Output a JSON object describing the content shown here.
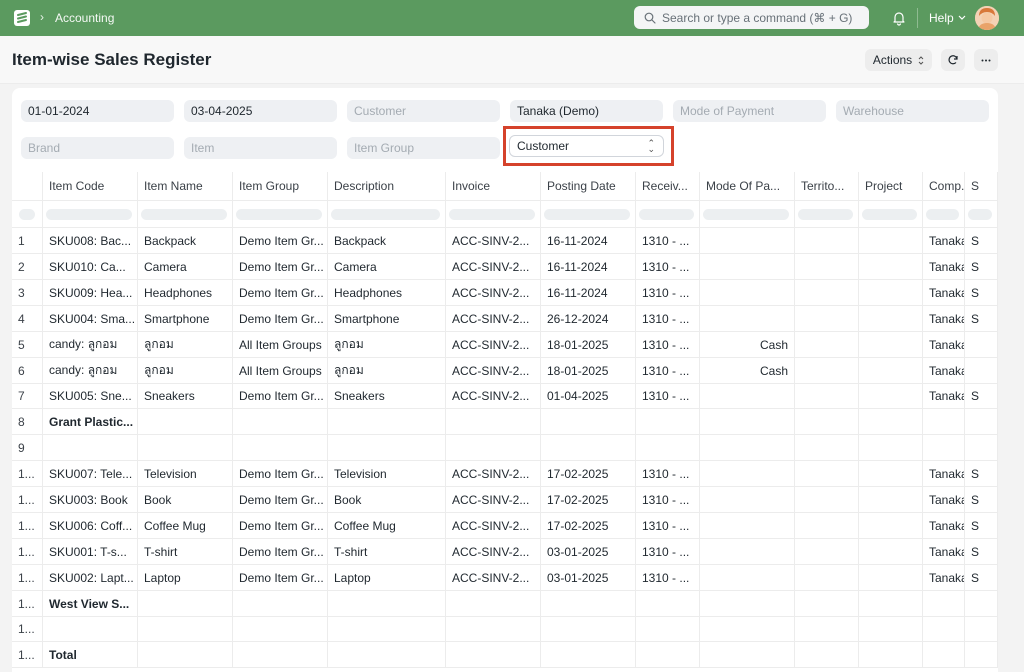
{
  "nav": {
    "breadcrumb": "Accounting",
    "search_placeholder": "Search or type a command (⌘ + G)",
    "help_label": "Help"
  },
  "page": {
    "title": "Item-wise Sales Register",
    "actions_label": "Actions"
  },
  "filters": {
    "from_date": "01-01-2024",
    "to_date": "03-04-2025",
    "customer_placeholder": "Customer",
    "company": "Tanaka (Demo)",
    "mode_of_payment_placeholder": "Mode of Payment",
    "warehouse_placeholder": "Warehouse",
    "brand_placeholder": "Brand",
    "item_placeholder": "Item",
    "item_group_placeholder": "Item Group",
    "group_by_value": "Customer"
  },
  "table": {
    "columns": [
      "Item Code",
      "Item Name",
      "Item Group",
      "Description",
      "Invoice",
      "Posting Date",
      "Receiv...",
      "Mode Of Pa...",
      "Territo...",
      "Project",
      "Comp...",
      "S"
    ],
    "rows": [
      {
        "n": "1",
        "item_code": "SKU008: Bac...",
        "item_name": "Backpack",
        "item_group": "Demo Item Gr...",
        "description": "Backpack",
        "invoice": "ACC-SINV-2...",
        "posting_date": "16-11-2024",
        "receivable": "1310 - ...",
        "mode_of_payment": "",
        "territory": "",
        "project": "",
        "company": "Tanaka ...",
        "s": "S"
      },
      {
        "n": "2",
        "item_code": "SKU010: Ca...",
        "item_name": "Camera",
        "item_group": "Demo Item Gr...",
        "description": "Camera",
        "invoice": "ACC-SINV-2...",
        "posting_date": "16-11-2024",
        "receivable": "1310 - ...",
        "mode_of_payment": "",
        "territory": "",
        "project": "",
        "company": "Tanaka ...",
        "s": "S"
      },
      {
        "n": "3",
        "item_code": "SKU009: Hea...",
        "item_name": "Headphones",
        "item_group": "Demo Item Gr...",
        "description": "Headphones",
        "invoice": "ACC-SINV-2...",
        "posting_date": "16-11-2024",
        "receivable": "1310 - ...",
        "mode_of_payment": "",
        "territory": "",
        "project": "",
        "company": "Tanaka ...",
        "s": "S"
      },
      {
        "n": "4",
        "item_code": "SKU004: Sma...",
        "item_name": "Smartphone",
        "item_group": "Demo Item Gr...",
        "description": "Smartphone",
        "invoice": "ACC-SINV-2...",
        "posting_date": "26-12-2024",
        "receivable": "1310 - ...",
        "mode_of_payment": "",
        "territory": "",
        "project": "",
        "company": "Tanaka ...",
        "s": "S"
      },
      {
        "n": "5",
        "item_code": "candy: ลูกอม",
        "item_name": "ลูกอม",
        "item_group": "All Item Groups",
        "description": "ลูกอม",
        "invoice": "ACC-SINV-2...",
        "posting_date": "18-01-2025",
        "receivable": "1310 - ...",
        "mode_of_payment": "Cash",
        "territory": "",
        "project": "",
        "company": "Tanaka ...",
        "s": ""
      },
      {
        "n": "6",
        "item_code": "candy: ลูกอม",
        "item_name": "ลูกอม",
        "item_group": "All Item Groups",
        "description": "ลูกอม",
        "invoice": "ACC-SINV-2...",
        "posting_date": "18-01-2025",
        "receivable": "1310 - ...",
        "mode_of_payment": "Cash",
        "territory": "",
        "project": "",
        "company": "Tanaka ...",
        "s": ""
      },
      {
        "n": "7",
        "item_code": "SKU005: Sne...",
        "item_name": "Sneakers",
        "item_group": "Demo Item Gr...",
        "description": "Sneakers",
        "invoice": "ACC-SINV-2...",
        "posting_date": "01-04-2025",
        "receivable": "1310 - ...",
        "mode_of_payment": "",
        "territory": "",
        "project": "",
        "company": "Tanaka ...",
        "s": "S"
      },
      {
        "n": "8",
        "item_code": "Grant Plastic...",
        "bold": true,
        "item_name": "",
        "item_group": "",
        "description": "",
        "invoice": "",
        "posting_date": "",
        "receivable": "",
        "mode_of_payment": "",
        "territory": "",
        "project": "",
        "company": "",
        "s": ""
      },
      {
        "n": "9",
        "item_code": "",
        "item_name": "",
        "item_group": "",
        "description": "",
        "invoice": "",
        "posting_date": "",
        "receivable": "",
        "mode_of_payment": "",
        "territory": "",
        "project": "",
        "company": "",
        "s": ""
      },
      {
        "n": "1...",
        "item_code": "SKU007: Tele...",
        "item_name": "Television",
        "item_group": "Demo Item Gr...",
        "description": "Television",
        "invoice": "ACC-SINV-2...",
        "posting_date": "17-02-2025",
        "receivable": "1310 - ...",
        "mode_of_payment": "",
        "territory": "",
        "project": "",
        "company": "Tanaka ...",
        "s": "S"
      },
      {
        "n": "1...",
        "item_code": "SKU003: Book",
        "item_name": "Book",
        "item_group": "Demo Item Gr...",
        "description": "Book",
        "invoice": "ACC-SINV-2...",
        "posting_date": "17-02-2025",
        "receivable": "1310 - ...",
        "mode_of_payment": "",
        "territory": "",
        "project": "",
        "company": "Tanaka ...",
        "s": "S"
      },
      {
        "n": "1...",
        "item_code": "SKU006: Coff...",
        "item_name": "Coffee Mug",
        "item_group": "Demo Item Gr...",
        "description": "Coffee Mug",
        "invoice": "ACC-SINV-2...",
        "posting_date": "17-02-2025",
        "receivable": "1310 - ...",
        "mode_of_payment": "",
        "territory": "",
        "project": "",
        "company": "Tanaka ...",
        "s": "S"
      },
      {
        "n": "1...",
        "item_code": "SKU001: T-s...",
        "item_name": "T-shirt",
        "item_group": "Demo Item Gr...",
        "description": "T-shirt",
        "invoice": "ACC-SINV-2...",
        "posting_date": "03-01-2025",
        "receivable": "1310 - ...",
        "mode_of_payment": "",
        "territory": "",
        "project": "",
        "company": "Tanaka ...",
        "s": "S"
      },
      {
        "n": "1...",
        "item_code": "SKU002: Lapt...",
        "item_name": "Laptop",
        "item_group": "Demo Item Gr...",
        "description": "Laptop",
        "invoice": "ACC-SINV-2...",
        "posting_date": "03-01-2025",
        "receivable": "1310 - ...",
        "mode_of_payment": "",
        "territory": "",
        "project": "",
        "company": "Tanaka ...",
        "s": "S"
      },
      {
        "n": "1...",
        "item_code": "West View S...",
        "bold": true,
        "item_name": "",
        "item_group": "",
        "description": "",
        "invoice": "",
        "posting_date": "",
        "receivable": "",
        "mode_of_payment": "",
        "territory": "",
        "project": "",
        "company": "",
        "s": ""
      },
      {
        "n": "1...",
        "item_code": "",
        "item_name": "",
        "item_group": "",
        "description": "",
        "invoice": "",
        "posting_date": "",
        "receivable": "",
        "mode_of_payment": "",
        "territory": "",
        "project": "",
        "company": "",
        "s": ""
      },
      {
        "n": "1...",
        "item_code": "Total",
        "bold": true,
        "item_name": "",
        "item_group": "",
        "description": "",
        "invoice": "",
        "posting_date": "",
        "receivable": "",
        "mode_of_payment": "",
        "territory": "",
        "project": "",
        "company": "",
        "s": ""
      }
    ]
  },
  "colors": {
    "navbar": "#5b9a5f",
    "highlight": "#d5422b"
  }
}
